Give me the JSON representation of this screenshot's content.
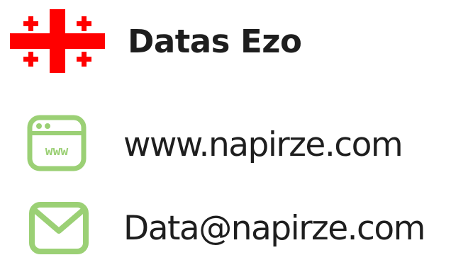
{
  "header": {
    "flag_icon": "georgian-flag-icon",
    "name": "Datas Ezo"
  },
  "contacts": {
    "website": {
      "icon": "browser-www-icon",
      "icon_text": "www",
      "text": "www.napirze.com"
    },
    "email": {
      "icon": "envelope-icon",
      "text": "Data@napirze.com"
    }
  },
  "colors": {
    "flag_red": "#ff0000",
    "icon_green": "#9bd075",
    "text": "#1e1e1e",
    "background": "#ffffff"
  }
}
